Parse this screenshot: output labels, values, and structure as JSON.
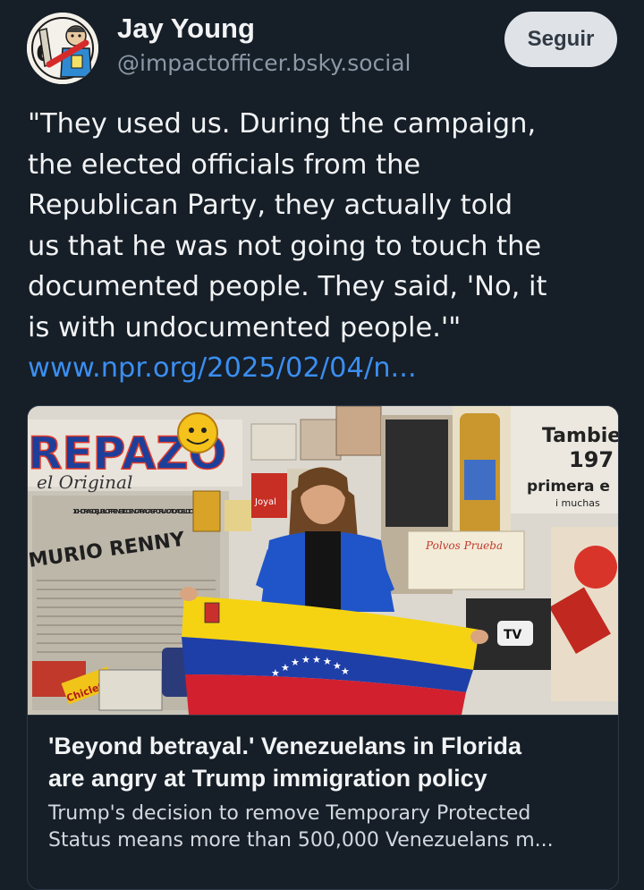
{
  "author": {
    "name": "Jay Young",
    "handle": "@impactofficer.bsky.social",
    "avatar_icon": "cartoon-officer-avatar"
  },
  "follow_button": {
    "label": "Seguir"
  },
  "post": {
    "text_lines": [
      "\"They used us. During the campaign,",
      "the elected officials from the",
      "Republican Party, they actually told",
      "us that he was not going to touch the",
      "documented people. They said, 'No, it",
      "is with undocumented people.'\""
    ],
    "link_text": "www.npr.org/2025/02/04/n..."
  },
  "link_card": {
    "image_text": {
      "store_sign": "REPAZO",
      "store_tagline": "el Original",
      "newspaper_headline_1": "10 HORAS DE JUBILO FRENETICO EN CARACAS POR LA CAIDA DEL DICTADOR",
      "newspaper_headline_2": "MURIO RENNY",
      "poster_text_1": "Tambie",
      "poster_text_2": "197",
      "poster_text_3": "primera e",
      "poster_text_4": "i muchas",
      "poster_tv": "TV",
      "snack_label": "Chiclets",
      "jar_label": "Joyal",
      "ad_text": "Polvos Prueba"
    },
    "title_lines": [
      "'Beyond betrayal.' Venezuelans in Florida",
      "are angry at Trump immigration policy"
    ],
    "description_lines": [
      "Trump's decision to remove Temporary Protected",
      "Status means more than 500,000 Venezuelans m..."
    ]
  },
  "colors": {
    "background": "#161e27",
    "text": "#f1f3f5",
    "handle": "#8b98a7",
    "link": "#3b8ef0",
    "button_bg": "#dfe3e8",
    "flag_yellow": "#f5d312",
    "flag_blue": "#1f3fa8",
    "flag_red": "#d2202f"
  }
}
